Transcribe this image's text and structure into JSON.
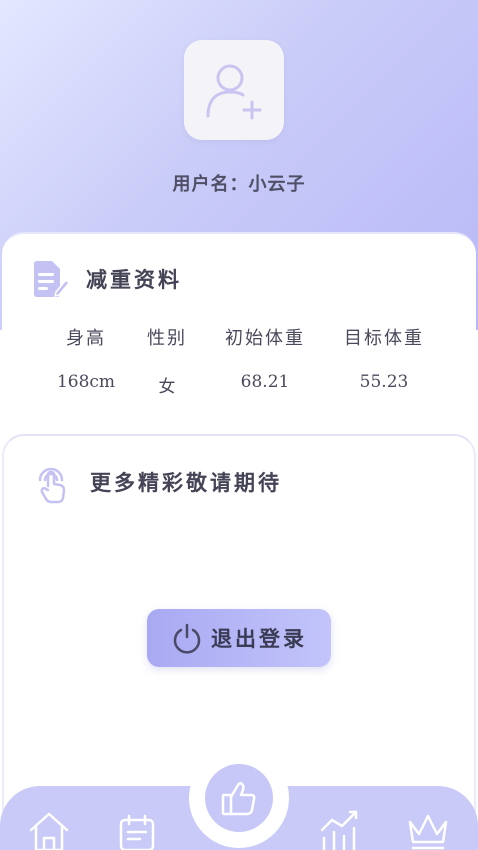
{
  "profile": {
    "username_label": "用户名：",
    "username": "小云子"
  },
  "weight_profile": {
    "title": "减重资料",
    "headers": [
      "身高",
      "性别",
      "初始体重",
      "目标体重"
    ],
    "values": [
      "168cm",
      "女",
      "68.21",
      "55.23"
    ]
  },
  "more": {
    "title": "更多精彩敬请期待"
  },
  "logout": {
    "label": "退出登录"
  },
  "tabbar": {
    "items": [
      "home-icon",
      "calendar-icon",
      "thumbs-up-icon",
      "chart-icon",
      "crown-icon"
    ]
  },
  "colors": {
    "accent": "#b9b8f7",
    "icon_purple": "#c3c2f3",
    "text_dark": "#4a4a5c"
  }
}
